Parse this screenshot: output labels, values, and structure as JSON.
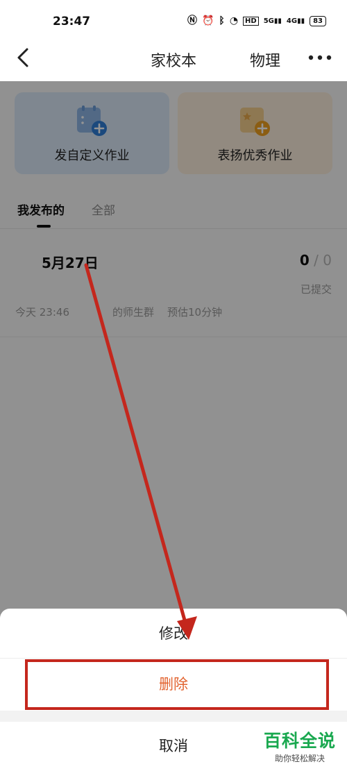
{
  "status_bar": {
    "time": "23:47",
    "icons": [
      "nfc-icon",
      "alarm-icon",
      "bluetooth-icon",
      "wifi-icon",
      "hd-icon",
      "signal-5g-icon",
      "signal-4g-icon"
    ],
    "network_5g": "5G",
    "network_4g": "4G",
    "hd_label": "HD",
    "battery": "83"
  },
  "header": {
    "title": "家校本",
    "subject": "物理"
  },
  "cards": {
    "custom_label": "发自定义作业",
    "praise_label": "表扬优秀作业"
  },
  "tabs": {
    "mine": "我发布的",
    "all": "全部"
  },
  "homework": {
    "title": "5月27日",
    "submitted_count": "0",
    "separator": "/",
    "total_count": "0",
    "submitted_label": "已提交",
    "time": "今天 23:46",
    "group": "的师生群",
    "estimate": "预估10分钟"
  },
  "action_sheet": {
    "edit": "修改",
    "delete": "删除",
    "cancel": "取消"
  },
  "watermark": {
    "title": "百科全说",
    "subtitle": "助你轻松解决"
  },
  "colors": {
    "delete_accent": "#e2632f",
    "highlight": "#c4271d",
    "card_blue": "#dbe9f8",
    "card_orange": "#fbeedd",
    "brand_green": "#19a84f"
  }
}
